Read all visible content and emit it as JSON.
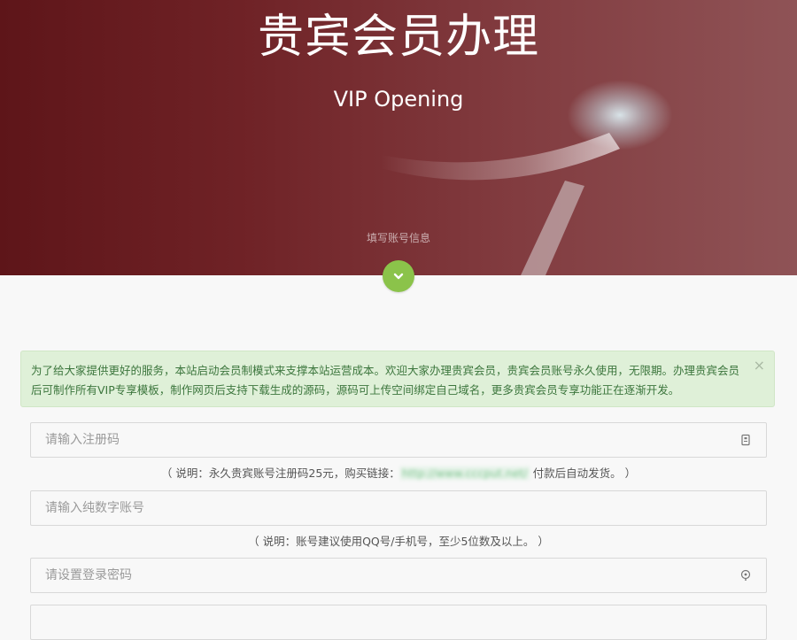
{
  "hero": {
    "title": "贵宾会员办理",
    "subtitle": "VIP Opening",
    "step_label": "填写账号信息",
    "down_icon": "chevron-down-icon",
    "colors": {
      "background": "#6f2226",
      "accent": "#8bc34a"
    }
  },
  "notice": {
    "text": "为了给大家提供更好的服务，本站启动会员制模式来支撑本站运营成本。欢迎大家办理贵宾会员，贵宾会员账号永久使用，无限期。办理贵宾会员后可制作所有VIP专享模板，制作网页后支持下载生成的源码，源码可上传空间绑定自己域名，更多贵宾会员专享功能正在逐渐开发。",
    "close_label": "×",
    "colors": {
      "background": "#dff0d8",
      "text": "#3c763d"
    }
  },
  "form": {
    "reg_code": {
      "placeholder": "请输入注册码",
      "icon": "card-icon"
    },
    "reg_hint": {
      "prefix": "（ 说明：永久贵宾账号注册码25元，购买链接：",
      "link": "http://www.cccput.net/",
      "suffix": " 付款后自动发货。 ）"
    },
    "account": {
      "placeholder": "请输入纯数字账号"
    },
    "account_hint": "（ 说明：账号建议使用QQ号/手机号，至少5位数及以上。 ）",
    "password": {
      "placeholder": "请设置登录密码",
      "icon": "lock-icon"
    }
  }
}
